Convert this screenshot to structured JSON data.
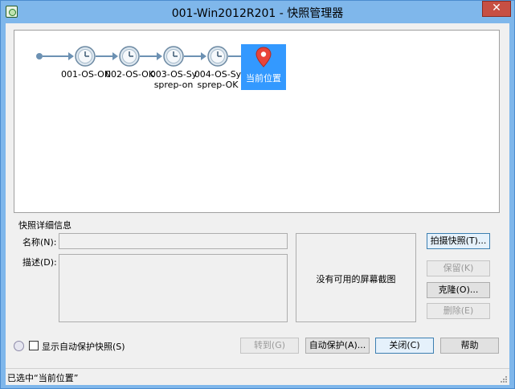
{
  "window": {
    "title": "001-Win2012R201 - 快照管理器",
    "close_symbol": "✕"
  },
  "tree": {
    "snapshots": [
      {
        "name_line1": "001-OS-ON",
        "name_line2": ""
      },
      {
        "name_line1": "002-OS-OK",
        "name_line2": ""
      },
      {
        "name_line1": "003-OS-Sy",
        "name_line2": "sprep-on"
      },
      {
        "name_line1": "004-OS-Sy",
        "name_line2": "sprep-OK"
      }
    ],
    "current_label": "当前位置",
    "current_icon": "map-pin-icon",
    "snapshot_icon": "clock-icon"
  },
  "details": {
    "section_title": "快照详细信息",
    "name_label": "名称(N):",
    "name_value": "",
    "desc_label": "描述(D):",
    "desc_value": "",
    "preview_text": "没有可用的屏幕截图"
  },
  "buttons": {
    "take_snapshot": "拍摄快照(T)...",
    "keep": "保留(K)",
    "clone": "克隆(O)...",
    "delete": "删除(E)",
    "goto": "转到(G)",
    "autoprotect": "自动保护(A)...",
    "close": "关闭(C)",
    "help": "帮助"
  },
  "options": {
    "show_autoprotect_label": "显示自动保护快照(S)",
    "show_autoprotect_checked": false
  },
  "status": {
    "text": "已选中“当前位置”"
  },
  "colors": {
    "titlebar": "#7fb7eb",
    "selection": "#3399ff",
    "pin": "#e8443a",
    "close": "#c74f43"
  }
}
